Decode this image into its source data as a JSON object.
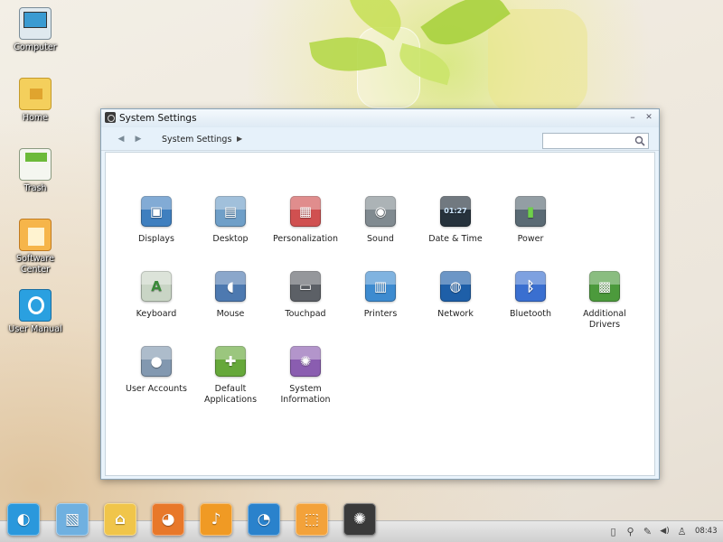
{
  "desktop": {
    "icons": [
      {
        "label": "Computer",
        "icon": "computer-icon",
        "color": "#4aa6d8"
      },
      {
        "label": "Home",
        "icon": "home-folder-icon",
        "color": "#f0c54a"
      },
      {
        "label": "Trash",
        "icon": "trash-icon",
        "color": "#7cc24a"
      },
      {
        "label": "Software Center",
        "icon": "software-center-icon",
        "color": "#f3a23a"
      },
      {
        "label": "User Manual",
        "icon": "user-manual-icon",
        "color": "#2aa0e0"
      }
    ]
  },
  "window": {
    "title": "System Settings",
    "minimize_symbol": "–",
    "close_symbol": "✕",
    "toolbar": {
      "back_symbol": "◀",
      "forward_symbol": "▶",
      "breadcrumb": "System Settings",
      "breadcrumb_arrow": "▶",
      "search_placeholder": "",
      "search_value": ""
    },
    "items": [
      {
        "label": "Displays",
        "icon": "displays-icon",
        "color": "#3f7fbf",
        "symbol": "▣"
      },
      {
        "label": "Desktop",
        "icon": "desktop-icon",
        "color": "#6f9fc8",
        "symbol": "▤"
      },
      {
        "label": "Personalization",
        "icon": "personalization-icon",
        "color": "#d05050",
        "symbol": "▦"
      },
      {
        "label": "Sound",
        "icon": "sound-icon",
        "color": "#808a90",
        "symbol": "◉"
      },
      {
        "label": "Date & Time",
        "icon": "clock-icon",
        "color": "#26323c",
        "symbol": "01:27"
      },
      {
        "label": "Power",
        "icon": "power-icon",
        "color": "#5a6a74",
        "symbol": "▮"
      },
      {
        "label": "Keyboard",
        "icon": "keyboard-icon",
        "color": "#c9d5c5",
        "symbol": "A"
      },
      {
        "label": "Mouse",
        "icon": "mouse-icon",
        "color": "#4d79b0",
        "symbol": "◖"
      },
      {
        "label": "Touchpad",
        "icon": "touchpad-icon",
        "color": "#5c6066",
        "symbol": "▭"
      },
      {
        "label": "Printers",
        "icon": "printer-icon",
        "color": "#3d8bd0",
        "symbol": "▥"
      },
      {
        "label": "Network",
        "icon": "network-icon",
        "color": "#1e5fa8",
        "symbol": "◍"
      },
      {
        "label": "Bluetooth",
        "icon": "bluetooth-icon",
        "color": "#3a6fd0",
        "symbol": "ᛒ"
      },
      {
        "label": "Additional Drivers",
        "icon": "chip-icon",
        "color": "#4c9a3c",
        "symbol": "▩"
      },
      {
        "label": "User Accounts",
        "icon": "user-accounts-icon",
        "color": "#8298b0",
        "symbol": "●"
      },
      {
        "label": "Default Applications",
        "icon": "puzzle-icon",
        "color": "#66a83a",
        "symbol": "✚"
      },
      {
        "label": "System Information",
        "icon": "gear-icon",
        "color": "#8a5db0",
        "symbol": "✺"
      }
    ]
  },
  "taskbar": {
    "dock": [
      {
        "icon": "launcher-icon",
        "color": "#2a98dc",
        "symbol": "◐"
      },
      {
        "icon": "image-viewer-icon",
        "color": "#6fb0e0",
        "symbol": "▧"
      },
      {
        "icon": "home-folder-icon",
        "color": "#f0c54a",
        "symbol": "⌂"
      },
      {
        "icon": "firefox-icon",
        "color": "#e8782a",
        "symbol": "◕"
      },
      {
        "icon": "music-player-icon",
        "color": "#f09a24",
        "symbol": "♪"
      },
      {
        "icon": "chat-icon",
        "color": "#2a82cc",
        "symbol": "◔"
      },
      {
        "icon": "software-center-icon",
        "color": "#f3a23a",
        "symbol": "⬚"
      },
      {
        "icon": "system-settings-icon",
        "color": "#3a3a3a",
        "symbol": "✺"
      }
    ],
    "tray": [
      {
        "icon": "storage-icon",
        "symbol": "▯"
      },
      {
        "icon": "power-plug-icon",
        "symbol": "⚲"
      },
      {
        "icon": "pen-icon",
        "symbol": "✎"
      },
      {
        "icon": "volume-icon",
        "symbol": "◀)"
      },
      {
        "icon": "user-icon",
        "symbol": "♙"
      }
    ],
    "clock": "08:43"
  }
}
